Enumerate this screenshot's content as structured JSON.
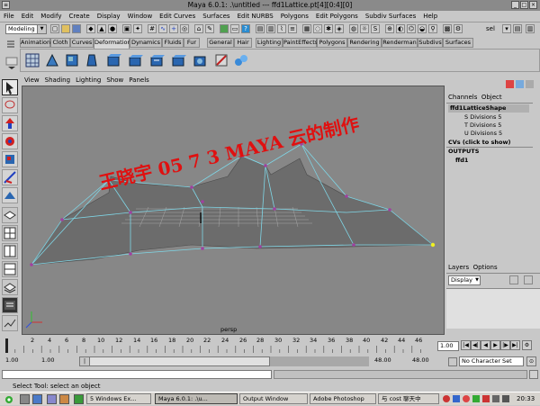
{
  "window": {
    "title": "Maya 6.0.1: .\\untitled   ---   ffd1Lattice.pt[4][0:4][0]"
  },
  "menubar": [
    "File",
    "Edit",
    "Modify",
    "Create",
    "Display",
    "Window",
    "Edit Curves",
    "Surfaces",
    "Edit NURBS",
    "Polygons",
    "Edit Polygons",
    "Subdiv Surfaces",
    "Help"
  ],
  "statusline": {
    "mode": "Modeling",
    "right_label": "sel"
  },
  "shelf": {
    "tabs": [
      "Animation",
      "Cloth",
      "Curves",
      "Deformation",
      "Dynamics",
      "Fluids",
      "Fur",
      "General",
      "Hair",
      "Lighting",
      "PaintEffects",
      "Polygons",
      "Rendering",
      "Renderman",
      "Subdivs",
      "Surfaces"
    ],
    "active_tab": "Deformation"
  },
  "panel": {
    "menus": [
      "View",
      "Shading",
      "Lighting",
      "Show",
      "Panels"
    ],
    "camera_label": "persp",
    "watermark": "王晓宇 05 7 3 MAYA 云的制作"
  },
  "channel_box": {
    "tabs": [
      "Channels",
      "Object"
    ],
    "node": "ffd1LatticeShape",
    "attributes": [
      {
        "name": "S Divisions",
        "value": "5"
      },
      {
        "name": "T Divisions",
        "value": "5"
      },
      {
        "name": "U Divisions",
        "value": "5"
      }
    ],
    "cvs_label": "CVs (click to show)",
    "outputs_label": "OUTPUTS",
    "output_node": "ffd1"
  },
  "layers": {
    "tabs": [
      "Layers",
      "Options"
    ],
    "display_select": "Display"
  },
  "timeline": {
    "ticks": [
      "2",
      "4",
      "6",
      "8",
      "10",
      "12",
      "14",
      "16",
      "18",
      "20",
      "22",
      "24",
      "26",
      "28",
      "30",
      "32",
      "34",
      "36",
      "38",
      "40",
      "42",
      "44",
      "46"
    ],
    "current_frame": "1.00"
  },
  "range": {
    "start": "1.00",
    "inner_start": "1.00",
    "inner_start_field": "1.00",
    "end": "48.00",
    "end2": "48.00",
    "character_set": "No Character Set"
  },
  "help_line": "Select Tool: select an object",
  "taskbar": {
    "items": [
      {
        "label": "5 Windows Ex...",
        "active": false
      },
      {
        "label": "Maya 6.0.1: .\\u...",
        "active": true
      },
      {
        "label": "Output Window",
        "active": false
      },
      {
        "label": "Adobe Photoshop",
        "active": false
      },
      {
        "label": "与 cost 聊天中",
        "active": false
      }
    ],
    "clock": "20:33"
  },
  "colors": {
    "viewport_bg": "#878787",
    "surface": "#6a6a6a",
    "lattice_wire": "#7fd6e6",
    "lattice_point": "#a040a0",
    "watermark": "#e01010",
    "selected_point": "#f0f020"
  }
}
